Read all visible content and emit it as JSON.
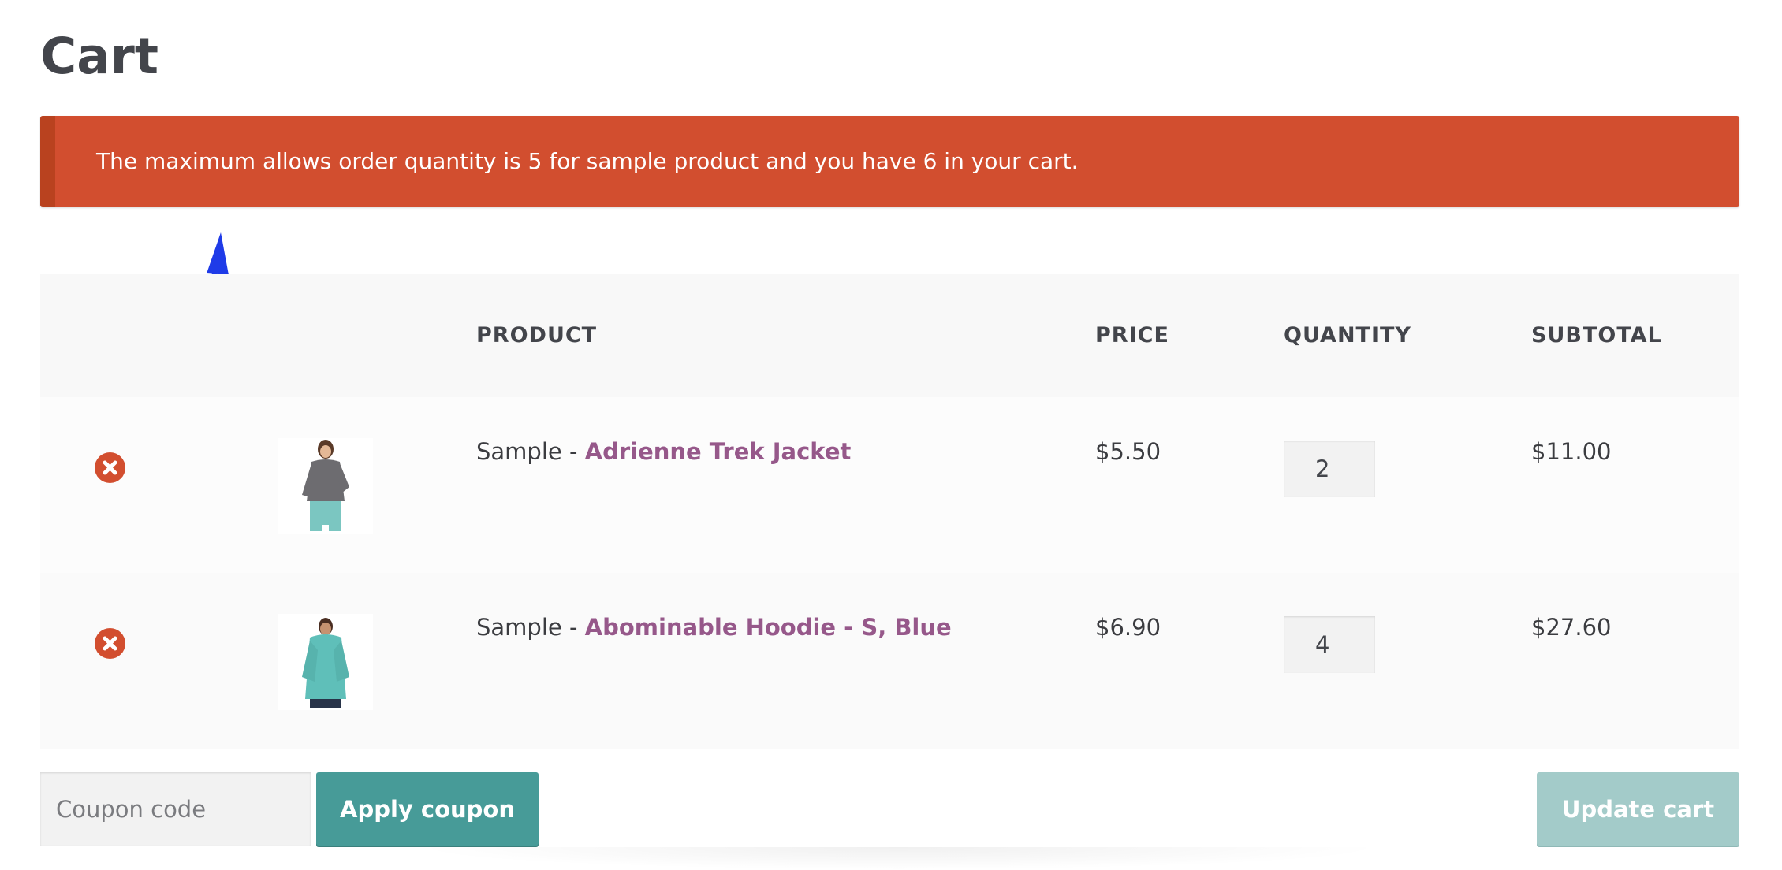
{
  "page": {
    "title": "Cart"
  },
  "notice": {
    "message": "The maximum allows order quantity is 5 for sample product and you have 6 in your cart.",
    "color": "#d24e2f"
  },
  "table": {
    "headers": {
      "product": "PRODUCT",
      "price": "PRICE",
      "quantity": "QUANTITY",
      "subtotal": "SUBTOTAL"
    },
    "rows": [
      {
        "prefix": "Sample - ",
        "name": "Adrienne Trek Jacket",
        "price": "$5.50",
        "quantity": "2",
        "subtotal": "$11.00",
        "thumbnail_icon": "gray-jacket-thumbnail"
      },
      {
        "prefix": "Sample - ",
        "name": "Abominable Hoodie - S, Blue",
        "price": "$6.90",
        "quantity": "4",
        "subtotal": "$27.60",
        "thumbnail_icon": "teal-hoodie-thumbnail"
      }
    ]
  },
  "actions": {
    "coupon_placeholder": "Coupon code",
    "apply_label": "Apply coupon",
    "update_label": "Update cart"
  },
  "colors": {
    "link": "#96588a",
    "primary_button": "#479b98",
    "disabled_button": "#a3cbc9",
    "annotation_arrow": "#1f3be8"
  }
}
